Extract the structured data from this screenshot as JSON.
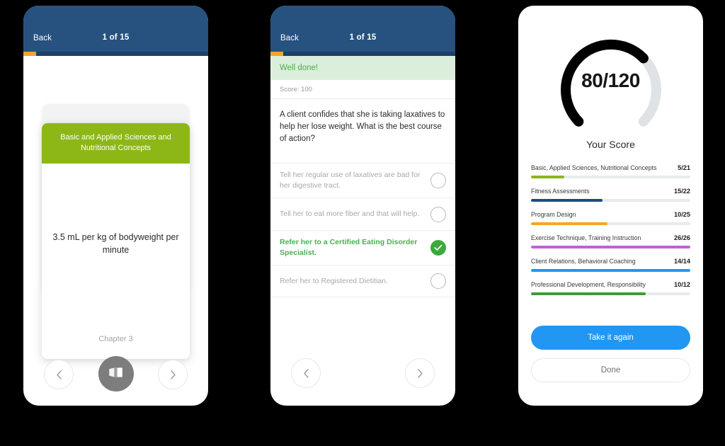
{
  "theme": {
    "header_blue": "#27527f",
    "progress_orange": "#f0a52e",
    "card_green": "#8cb717",
    "correct_green": "#4caf50",
    "primary_blue": "#2196f3"
  },
  "flashcard_screen": {
    "header": {
      "back_label": "Back",
      "title": "1 of 15",
      "progress_percent": 7
    },
    "card": {
      "category": "Basic and Applied Sciences and Nutritional Concepts",
      "answer": "3.5 mL per kg of bodyweight per minute",
      "chapter": "Chapter 3"
    },
    "nav": {
      "prev_icon": "chevron-left-icon",
      "flip_icon": "flip-card-icon",
      "next_icon": "chevron-right-icon"
    }
  },
  "quiz_screen": {
    "header": {
      "back_label": "Back",
      "title": "1 of 15",
      "progress_percent": 7
    },
    "feedback": "Well done!",
    "score_line": "Score: 100",
    "question": "A client confides that she is taking laxatives to help her lose weight. What is the best course of action?",
    "answers": [
      {
        "label": "Tell her regular use of laxatives are bad for her digestive tract.",
        "selected": false
      },
      {
        "label": "Tell her to eat more fiber and that will help.",
        "selected": false
      },
      {
        "label": "Refer her to a Certified Eating Disorder Specialist.",
        "selected": true
      },
      {
        "label": "Refer her to Registered Dietitian.",
        "selected": false
      }
    ],
    "nav": {
      "prev_icon": "chevron-left-icon",
      "next_icon": "chevron-right-icon"
    }
  },
  "results_screen": {
    "gauge": {
      "value_text": "80/120",
      "caption": "Your Score",
      "score": 80,
      "total": 120,
      "percent": 67,
      "arc_color": "#000000",
      "track_color": "#dfe3e6"
    },
    "breakdown": [
      {
        "name": "Basic, Applied Sciences, Nutritional Concepts",
        "fraction": "5/21",
        "percent": 21,
        "color": "#8cb717"
      },
      {
        "name": "Fitness Assessments",
        "fraction": "15/22",
        "percent": 45,
        "color": "#1f4e79"
      },
      {
        "name": "Program Design",
        "fraction": "10/25",
        "percent": 48,
        "color": "#f5a623"
      },
      {
        "name": "Exercise Technique, Training Instruction",
        "fraction": "26/26",
        "percent": 100,
        "color": "#c35fd6"
      },
      {
        "name": "Client Relations, Behavioral Coaching",
        "fraction": "14/14",
        "percent": 100,
        "color": "#2196f3"
      },
      {
        "name": "Professional Development, Responsibility",
        "fraction": "10/12",
        "percent": 72,
        "color": "#3f9c35"
      }
    ],
    "actions": {
      "primary_label": "Take it again",
      "secondary_label": "Done"
    }
  }
}
